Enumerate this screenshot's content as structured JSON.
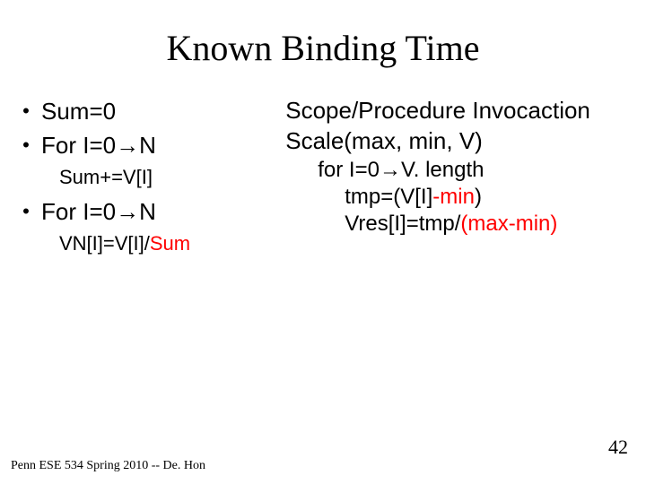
{
  "title": "Known Binding Time",
  "left": {
    "b1": "Sum=0",
    "b2_pre": "For I=0",
    "b2_post": "N",
    "sub1": "Sum+=V[I]",
    "b3_pre": "For I=0",
    "b3_post": "N",
    "sub2a": "VN[I]=V[I]/",
    "sub2b": "Sum"
  },
  "right": {
    "h1": "Scope/Procedure Invocaction",
    "h2": "Scale(max, min, V)",
    "l1_pre": "for I=0",
    "l1_post": "V. length",
    "l2a": "tmp=(V[I]",
    "l2b": "-min",
    "l2c": ")",
    "l3a": "Vres[I]=tmp/",
    "l3b": "(max-min)"
  },
  "arrow": "→",
  "footer": "Penn ESE 534 Spring 2010 -- De. Hon",
  "page": "42"
}
